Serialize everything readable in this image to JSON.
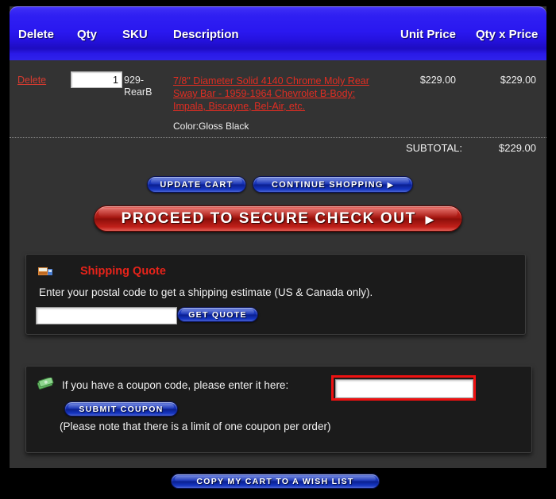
{
  "cart_table": {
    "columns": [
      "Delete",
      "Qty",
      "SKU",
      "Description",
      "Unit Price",
      "Qty x Price"
    ],
    "rows": [
      {
        "delete_label": "Delete",
        "qty_value": "1",
        "sku": "929-RearB",
        "description": "7/8\" Diameter Solid 4140 Chrome Moly Rear Sway Bar - 1959-1964 Chevrolet B-Body: Impala, Biscayne, Bel-Air, etc.",
        "option": "Color:Gloss Black",
        "unit_price": "$229.00",
        "extended_price": "$229.00"
      }
    ],
    "subtotal_label": "SUBTOTAL:",
    "subtotal_value": "$229.00"
  },
  "actions": {
    "update_cart": "UPDATE CART",
    "continue_shopping": "CONTINUE SHOPPING",
    "continue_arrow": "▶",
    "checkout": "PROCEED TO SECURE CHECK OUT",
    "checkout_arrow": "▶",
    "wish_list": "COPY MY CART TO A WISH LIST"
  },
  "shipping_quote": {
    "icon": "shipping-truck-icon",
    "title": "Shipping Quote",
    "instructions": "Enter your postal code to get a shipping estimate (US & Canada only).",
    "postal_value": "",
    "postal_placeholder": "",
    "button_label": "GET QUOTE"
  },
  "coupon": {
    "icon": "money-icon",
    "prompt": "If you have a coupon code, please enter it here:",
    "code_value": "",
    "code_placeholder": "",
    "button_label": "SUBMIT COUPON",
    "note": "(Please note that there is a limit of one coupon per order)"
  },
  "colors": {
    "header_blue": "#2512e0",
    "link_red": "#e02d22",
    "accent_red": "#e8231a",
    "highlight_red": "#ee1111",
    "panel_bg": "#1b1b1b",
    "page_bg": "#333333"
  }
}
